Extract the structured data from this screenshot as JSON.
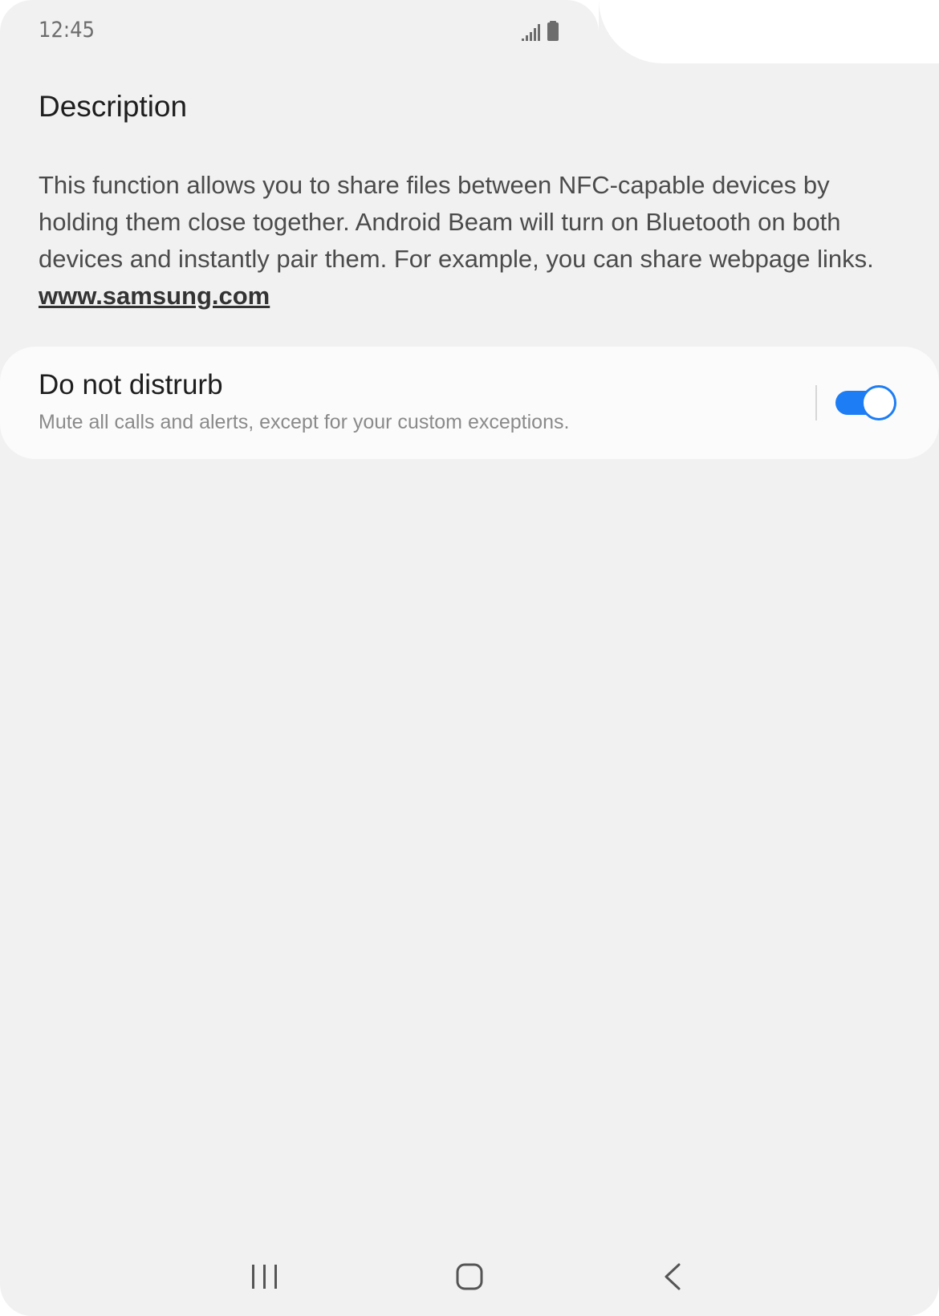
{
  "status_bar": {
    "time": "12:45",
    "icons": [
      "signal-icon",
      "battery-icon"
    ]
  },
  "description": {
    "title": "Description",
    "body": "This function allows you to share files between NFC-capable devices by\nholding them close together. Android Beam will  turn on Bluetooth on both\ndevices and instantly pair them. For example, you can share webpage links.",
    "link": "www.samsung.com"
  },
  "do_not_disturb": {
    "title": "Do not distrurb",
    "subtitle": "Mute all calls and alerts, except for your custom exceptions.",
    "enabled": true
  },
  "navigation": {
    "buttons": [
      "recents-icon",
      "home-icon",
      "back-icon"
    ]
  },
  "colors": {
    "background": "#f1f1f1",
    "card": "#fbfbfb",
    "accent": "#1d7df4"
  }
}
